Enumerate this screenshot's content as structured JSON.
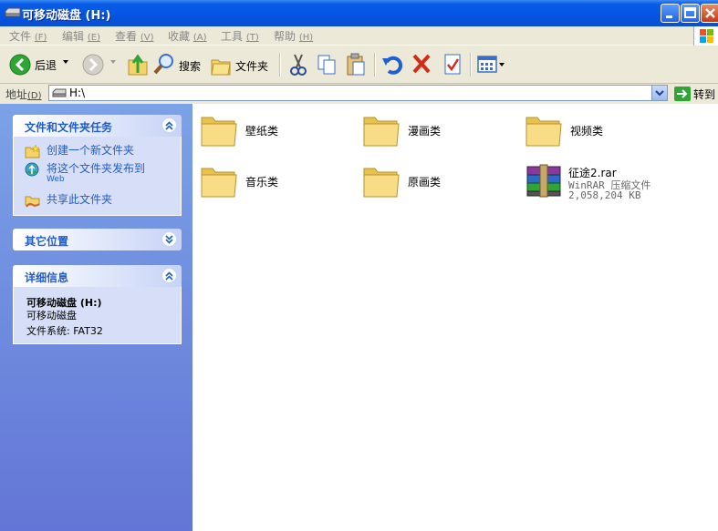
{
  "window": {
    "title": "可移动磁盘 (H:)",
    "icon": "drive-icon"
  },
  "menu": [
    {
      "label": "文件",
      "accel": "(F)"
    },
    {
      "label": "编辑",
      "accel": "(E)"
    },
    {
      "label": "查看",
      "accel": "(V)"
    },
    {
      "label": "收藏",
      "accel": "(A)"
    },
    {
      "label": "工具",
      "accel": "(T)"
    },
    {
      "label": "帮助",
      "accel": "(H)"
    }
  ],
  "toolbar": {
    "back": "后退",
    "search": "搜索",
    "folders": "文件夹"
  },
  "address": {
    "label": "地址",
    "accel": "(D)",
    "value": "H:\\",
    "go": "转到"
  },
  "left_pane": {
    "file_tasks": {
      "title": "文件和文件夹任务",
      "items": [
        {
          "label": "创建一个新文件夹",
          "icon": "new-folder-icon"
        },
        {
          "label": "将这个文件夹发布到",
          "sub": "Web",
          "icon": "publish-web-icon"
        },
        {
          "label": "共享此文件夹",
          "icon": "share-folder-icon"
        }
      ]
    },
    "other_places": {
      "title": "其它位置"
    },
    "details": {
      "title": "详细信息",
      "name": "可移动磁盘 (H:)",
      "type": "可移动磁盘",
      "fs_label": "文件系统: FAT32"
    }
  },
  "items": [
    {
      "name": "壁纸类",
      "kind": "folder"
    },
    {
      "name": "漫画类",
      "kind": "folder"
    },
    {
      "name": "视频类",
      "kind": "folder"
    },
    {
      "name": "音乐类",
      "kind": "folder"
    },
    {
      "name": "原画类",
      "kind": "folder"
    },
    {
      "name": "征途2.rar",
      "kind": "archive",
      "type": "WinRAR 压缩文件",
      "size": "2,058,204 KB"
    }
  ],
  "colors": {
    "titlebar": "#0454E2",
    "link": "#215DC6",
    "pane": "#7BA2E7"
  }
}
